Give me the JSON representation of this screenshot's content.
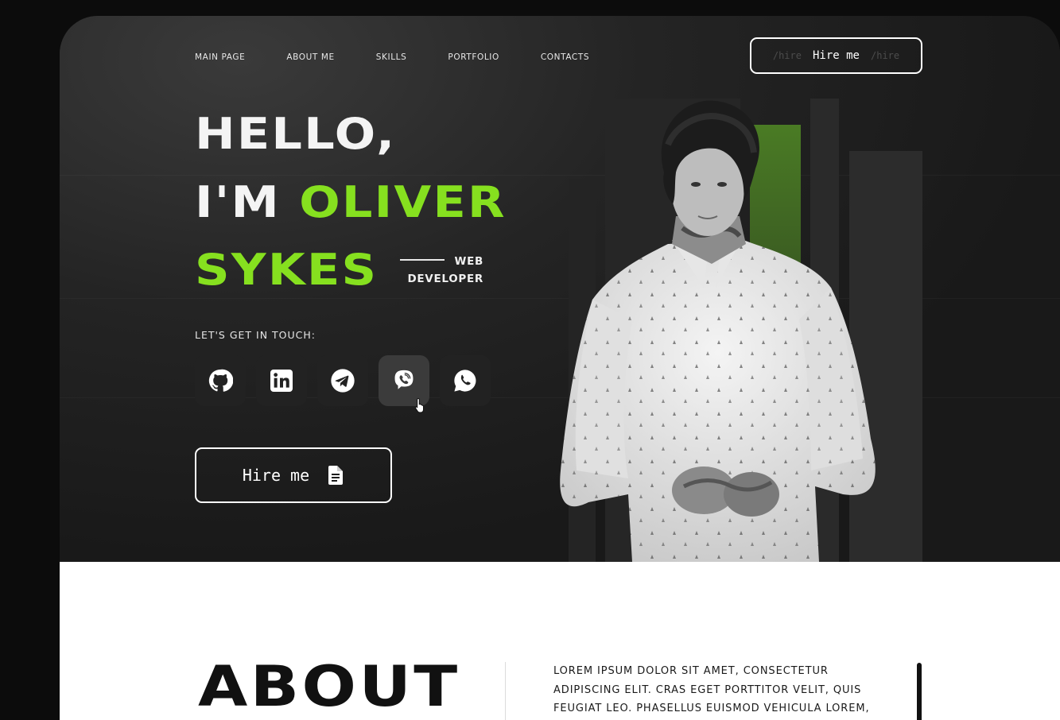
{
  "nav": {
    "items": [
      "MAIN PAGE",
      "ABOUT ME",
      "SKILLS",
      "PORTFOLIO",
      "CONTACTS"
    ],
    "hire_button": {
      "prefix": "/hire",
      "label": "Hire me",
      "suffix": "/hire"
    }
  },
  "hero": {
    "line1": "HELLO,",
    "line2_prefix": "I'M ",
    "first_name": "OLIVER",
    "last_name": "SYKES",
    "role": "WEB DEVELOPER",
    "touch_label": "LET'S GET IN TOUCH:",
    "socials": [
      {
        "icon": "github-icon"
      },
      {
        "icon": "linkedin-icon"
      },
      {
        "icon": "telegram-icon"
      },
      {
        "icon": "viber-icon",
        "active": true
      },
      {
        "icon": "whatsapp-icon"
      }
    ],
    "hire_button": {
      "label": "Hire me",
      "icon": "document-icon"
    },
    "accent_color": "#86e01f"
  },
  "about": {
    "title": "ABOUT",
    "text": "LOREM IPSUM DOLOR SIT AMET, CONSECTETUR ADIPISCING ELIT. CRAS EGET PORTTITOR VELIT, QUIS FEUGIAT LEO. PHASELLUS EUISMOD VEHICULA LOREM,"
  }
}
